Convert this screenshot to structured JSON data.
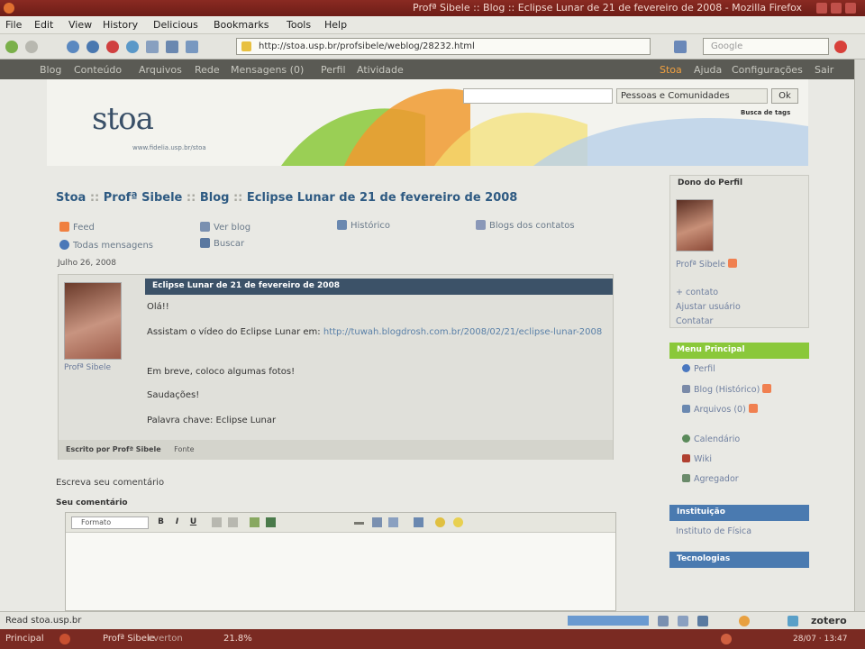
{
  "window": {
    "title": "Profª Sibele :: Blog :: Eclipse Lunar de 21 de fevereiro de 2008 - Mozilla Firefox"
  },
  "menubar": {
    "items": [
      "File",
      "Edit",
      "View",
      "History",
      "Delicious",
      "Bookmarks",
      "Tools",
      "Help"
    ]
  },
  "navbar": {
    "url": "http://stoa.usp.br/profsibele/weblog/28232.html",
    "search_placeholder": "Google"
  },
  "sitenav": {
    "items": [
      "Blog",
      "Conteúdo",
      "Arquivos",
      "Rede",
      "Mensagens (0)",
      "Perfil",
      "Atividade"
    ],
    "right_items": [
      "Sair",
      "Ajuda",
      "Configurações",
      "Stoa"
    ]
  },
  "banner": {
    "logo": "stoa",
    "tagline": "www.fidelia.usp.br/stoa",
    "search_scope": "Pessoas e Comunidades",
    "ok_label": "Ok",
    "advanced_label": "Busca de tags"
  },
  "breadcrumb": {
    "site": "Stoa",
    "author": "Profª Sibele",
    "section": "Blog",
    "title": "Eclipse Lunar de 21 de fevereiro de 2008",
    "sep": "::"
  },
  "actions": {
    "feed": "Feed",
    "view_blog": "Ver blog",
    "history": "Histórico",
    "contacts_blogs": "Blogs dos contatos",
    "all_posts": "Todas mensagens",
    "friends": "Buscar"
  },
  "post": {
    "date": "Julho 26, 2008",
    "title": "Eclipse Lunar de 21 de fevereiro de 2008",
    "author": "Profª Sibele",
    "line1": "Olá!!",
    "line2": "Assistam o vídeo do Eclipse Lunar em:",
    "link": "http://tuwah.blogdrosh.com.br/2008/02/21/eclipse-lunar-2008",
    "line3": "Em breve, coloco algumas fotos!",
    "line4": "Saudações!",
    "line5": "Palavra chave: Eclipse Lunar",
    "footer_by": "Escrito por Profª Sibele",
    "footer_perm": "Fonte"
  },
  "comments": {
    "header": "Escreva seu comentário",
    "your_comment": "Seu comentário",
    "format": "Formato"
  },
  "sidebar": {
    "owner_head": "Dono do Perfil",
    "owner_name": "Profª Sibele",
    "owner_links": [
      "+ contato",
      "Ajustar usuário",
      "Contatar"
    ],
    "menu_head": "Menu Principal",
    "menu_items": [
      "Perfil",
      "Blog (Histórico)",
      "Arquivos (0)",
      "Calendário",
      "Wiki",
      "Agregador"
    ],
    "inst_head": "Instituição",
    "inst_value": "Instituto de Física",
    "tags_head": "Tecnologias"
  },
  "statusbar": {
    "text": "Read stoa.usp.br",
    "zotero": "zotero"
  },
  "taskbar": {
    "start": "Principal",
    "items": [
      "Profª Sibele",
      "everton",
      "21.8%"
    ],
    "clock": "28/07 · 13:47"
  }
}
